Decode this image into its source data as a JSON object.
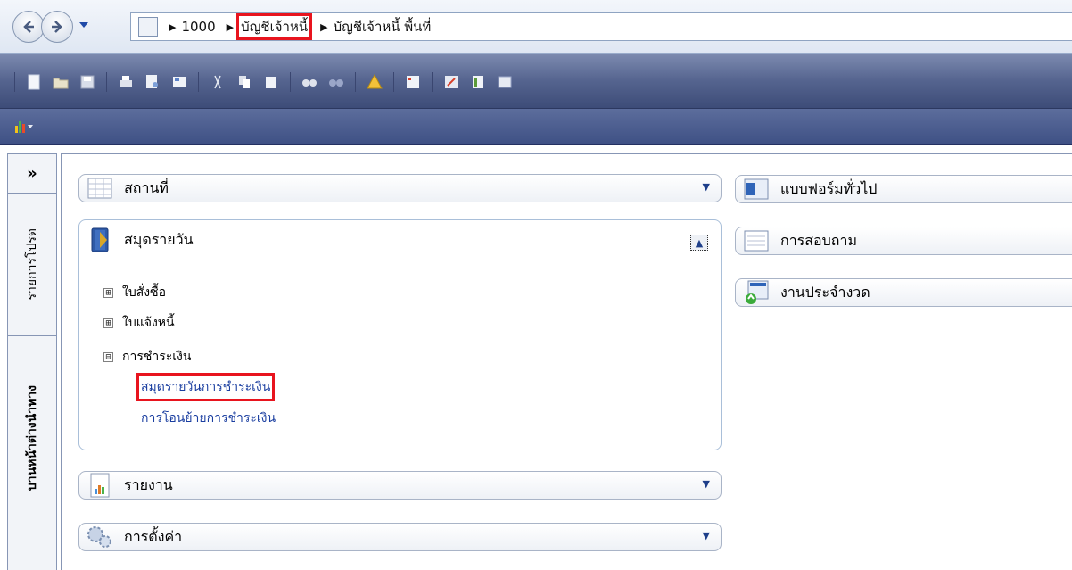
{
  "breadcrumb": {
    "items": [
      "1000",
      "บัญชีเจ้าหนี้",
      "บัญชีเจ้าหนี้ พื้นที่"
    ],
    "highlighted_index": 1
  },
  "toolbar": {
    "icons": [
      "new-icon",
      "open-icon",
      "save-icon",
      "print-icon",
      "print-preview-icon",
      "properties-icon",
      "cut-icon",
      "copy-icon",
      "paste-icon",
      "find-icon",
      "find-next-icon",
      "alert-icon",
      "list-icon",
      "export-icon",
      "layout-icon",
      "calculator-icon"
    ]
  },
  "sidebar": {
    "expand_label": "»",
    "tabs": [
      "รายการโปรด",
      "บานหน้าต่างนำทาง"
    ]
  },
  "left_groups": [
    {
      "label": "สถานที่",
      "icon": "table-icon",
      "expanded": false
    },
    {
      "label": "สมุดรายวัน",
      "icon": "journal-book-icon",
      "expanded": true
    },
    {
      "label": "รายงาน",
      "icon": "report-icon",
      "expanded": false
    },
    {
      "label": "การตั้งค่า",
      "icon": "settings-gears-icon",
      "expanded": false
    }
  ],
  "journal_tree": {
    "nodes": [
      {
        "label": "ใบสั่งซื้อ",
        "toggle": "⊞"
      },
      {
        "label": "ใบแจ้งหนี้",
        "toggle": "⊞"
      },
      {
        "label": "การชำระเงิน",
        "toggle": "⊟"
      }
    ],
    "links": [
      "สมุดรายวันการชำระเงิน",
      "การโอนย้ายการชำระเงิน"
    ],
    "highlighted_link_index": 0
  },
  "right_groups": [
    {
      "label": "แบบฟอร์มทั่วไป",
      "icon": "form-icon"
    },
    {
      "label": "การสอบถาม",
      "icon": "inquiry-icon"
    },
    {
      "label": "งานประจำงวด",
      "icon": "periodic-calendar-icon"
    }
  ],
  "colors": {
    "highlight": "#e8141e",
    "link": "#1a3ea0",
    "toolbar": "#55648f"
  }
}
